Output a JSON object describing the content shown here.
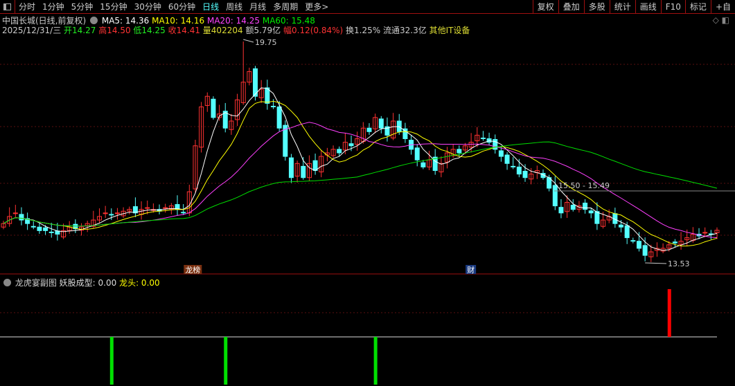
{
  "topbar": {
    "periods": [
      "分时",
      "1分钟",
      "5分钟",
      "15分钟",
      "30分钟",
      "60分钟",
      "日线",
      "周线",
      "月线",
      "多周期",
      "更多>"
    ],
    "active": "日线",
    "tools": [
      "复权",
      "叠加",
      "多股",
      "统计",
      "画线",
      "F10",
      "标记",
      "+自"
    ]
  },
  "info": {
    "title": "中国长城(日线,前复权)",
    "ma5": "MA5: 14.36",
    "ma10": "MA10: 14.16",
    "ma20": "MA20: 14.25",
    "ma60": "MA60: 15.48",
    "date": "2025/12/31/三",
    "open": "开14.27",
    "high": "高14.50",
    "low": "低14.25",
    "close": "收14.41",
    "vol": "量402204",
    "amount": "额5.79亿",
    "change": "幅0.12(0.84%)",
    "turnover": "换1.25%",
    "float": "流通32.3亿",
    "sector": "其他IT设备"
  },
  "colors": {
    "up": "#ff3232",
    "down": "#54ffff",
    "ma5": "#ffffff",
    "ma10": "#ffff00",
    "ma20": "#ff40ff",
    "ma60": "#00e000"
  },
  "chart_data": {
    "type": "candlestick",
    "price_range": [
      13.0,
      20.3
    ],
    "closes": [
      14.6,
      14.8,
      14.9,
      14.7,
      14.6,
      14.5,
      14.4,
      14.4,
      14.35,
      14.3,
      14.4,
      14.5,
      14.45,
      14.5,
      14.6,
      14.7,
      14.8,
      14.9,
      14.85,
      14.9,
      14.95,
      15.0,
      14.9,
      15.0,
      15.05,
      15.0,
      14.95,
      15.05,
      15.1,
      15.0,
      14.9,
      15.5,
      16.8,
      17.9,
      18.2,
      17.6,
      17.7,
      17.3,
      17.5,
      18.1,
      18.6,
      18.9,
      18.2,
      18.4,
      18.0,
      17.9,
      17.3,
      16.5,
      15.9,
      16.3,
      15.9,
      16.3,
      16.1,
      16.5,
      16.6,
      16.7,
      16.6,
      16.9,
      16.8,
      17.0,
      17.3,
      17.2,
      17.6,
      17.3,
      17.1,
      17.5,
      17.2,
      17.0,
      16.7,
      16.4,
      16.2,
      16.4,
      16.1,
      16.3,
      16.6,
      16.7,
      16.6,
      16.8,
      16.9,
      17.1,
      17.0,
      16.9,
      16.7,
      16.5,
      16.3,
      16.2,
      16.0,
      15.9,
      16.0,
      16.1,
      15.9,
      15.6,
      15.1,
      14.9,
      15.2,
      15.0,
      15.1,
      15.0,
      14.9,
      14.6,
      14.7,
      14.8,
      14.6,
      14.5,
      14.2,
      14.1,
      13.9,
      13.7,
      13.8,
      13.9,
      13.9,
      14.0,
      14.05,
      14.1,
      14.2,
      14.3,
      14.25,
      14.35,
      14.3,
      14.41
    ],
    "max_label": "19.75",
    "max_value": 19.75,
    "min_label": "13.53",
    "min_value": 13.53,
    "range_label": "15.50 - 15.49",
    "events": [
      {
        "label": "龙榜",
        "index": 31
      },
      {
        "label": "财",
        "index": 78
      }
    ]
  },
  "sub": {
    "title": "龙虎宴副图",
    "f1": "妖股成型: 0.00",
    "f2": "龙头: 0.00",
    "green_bars": [
      18,
      37,
      62
    ],
    "red_bars": [
      111
    ]
  }
}
